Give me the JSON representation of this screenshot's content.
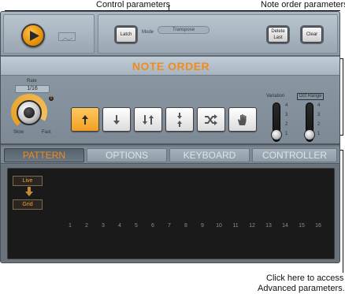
{
  "callouts": {
    "control_parameters": "Control parameters",
    "note_order_parameters": "Note order parameters",
    "advanced_line1": "Click here to access",
    "advanced_line2": "Advanced parameters."
  },
  "topbar": {
    "latch_label": "Latch",
    "mode_label": "Mode",
    "mode_value": "Transpose",
    "delete_label": "Delete Last",
    "clear_label": "Clear"
  },
  "note_order": {
    "title": "NOTE ORDER",
    "rate_label": "Rate",
    "rate_value": "1/16",
    "slow_label": "Slow",
    "fast_label": "Fast",
    "rate_dot": "0",
    "buttons": [
      {
        "icon": "arrow-up-icon",
        "active": true
      },
      {
        "icon": "arrow-down-icon",
        "active": false
      },
      {
        "icon": "arrow-down-up-icon",
        "active": false
      },
      {
        "icon": "arrow-in-out-icon",
        "active": false
      },
      {
        "icon": "shuffle-icon",
        "active": false
      },
      {
        "icon": "hand-icon",
        "active": false
      }
    ],
    "variation_label": "Variation",
    "variation_ticks": [
      "4",
      "3",
      "2",
      "1"
    ],
    "variation_value": 1,
    "oct_range_label": "Oct Range",
    "oct_range_ticks": [
      "4",
      "3",
      "2",
      "1"
    ],
    "oct_range_value": 1
  },
  "tabs": [
    {
      "label": "PATTERN",
      "active": true
    },
    {
      "label": "OPTIONS",
      "active": false
    },
    {
      "label": "KEYBOARD",
      "active": false
    },
    {
      "label": "CONTROLLER",
      "active": false
    }
  ],
  "pattern": {
    "live_label": "Live",
    "grid_label": "Grid",
    "steps": [
      "1",
      "2",
      "3",
      "4",
      "5",
      "6",
      "7",
      "8",
      "9",
      "10",
      "11",
      "12",
      "13",
      "14",
      "15",
      "16"
    ]
  },
  "colors": {
    "accent": "#f08c1a"
  }
}
